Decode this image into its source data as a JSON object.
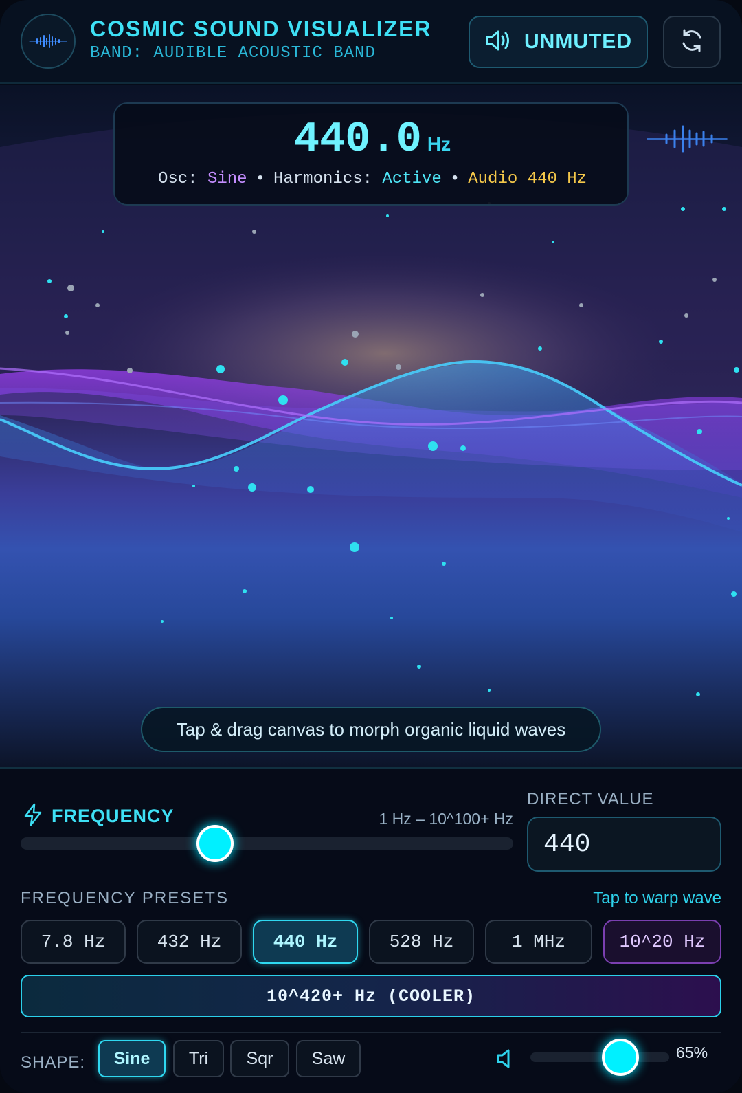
{
  "header": {
    "title": "COSMIC SOUND VISUALIZER",
    "band": "BAND: AUDIBLE ACOUSTIC BAND",
    "mute_label": "UNMUTED"
  },
  "readout": {
    "frequency_value": "440.0",
    "frequency_unit": "Hz",
    "osc_label": "Osc:",
    "osc_value": "Sine",
    "harmonics_label": "Harmonics:",
    "harmonics_value": "Active",
    "audio_label": "Audio 440 Hz",
    "separator": "•"
  },
  "canvas": {
    "hint": "Tap & drag canvas to morph organic liquid waves"
  },
  "controls": {
    "frequency_label": "FREQUENCY",
    "range_label": "1 Hz – 10^100+ Hz",
    "frequency_slider_fraction": 0.395,
    "direct_value_label": "DIRECT VALUE",
    "direct_value": "440",
    "presets_label": "FREQUENCY PRESETS",
    "presets_hint": "Tap to warp wave",
    "presets": [
      {
        "label": "7.8 Hz",
        "state": "normal"
      },
      {
        "label": "432 Hz",
        "state": "normal"
      },
      {
        "label": "440 Hz",
        "state": "active"
      },
      {
        "label": "528 Hz",
        "state": "normal"
      },
      {
        "label": "1 MHz",
        "state": "normal"
      },
      {
        "label": "10^20 Hz",
        "state": "violet"
      }
    ],
    "cooler_label": "10^420+ Hz (COOLER)",
    "shape_label": "SHAPE:",
    "shapes": [
      {
        "label": "Sine",
        "active": true
      },
      {
        "label": "Tri",
        "active": false
      },
      {
        "label": "Sqr",
        "active": false
      },
      {
        "label": "Saw",
        "active": false
      }
    ],
    "volume_value": "65%",
    "volume_fraction": 0.65
  },
  "icons": {
    "logo": "waveform-icon",
    "mute": "speaker-icon",
    "reset": "refresh-icon",
    "frequency": "lightning-icon",
    "volume": "speaker-small-icon"
  },
  "colors": {
    "accent": "#3ee0f5",
    "violet": "#c48dff",
    "gold": "#f5c84a",
    "background": "#060b18"
  }
}
